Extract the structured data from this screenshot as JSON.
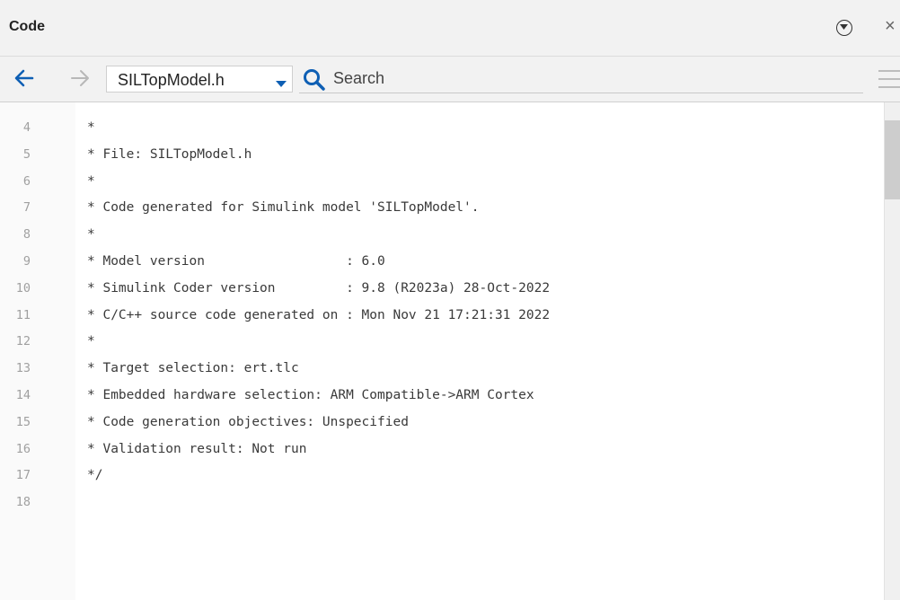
{
  "panel": {
    "title": "Code",
    "menu_icon": "circle-chevron-down-icon",
    "close_label": "×"
  },
  "toolbar": {
    "back_icon": "arrow-left-icon",
    "forward_icon": "arrow-right-icon",
    "file_selector": "SILTopModel.h",
    "search_placeholder": "Search",
    "search_value": "",
    "menu_icon": "hamburger-icon"
  },
  "colors": {
    "accent": "#0e5fb4",
    "line_number": "#a0a0a0",
    "code_text": "#3a3a3a"
  },
  "editor": {
    "lines": [
      {
        "n": "4",
        "text": "*"
      },
      {
        "n": "5",
        "text": "* File: SILTopModel.h"
      },
      {
        "n": "6",
        "text": "*"
      },
      {
        "n": "7",
        "text": "* Code generated for Simulink model 'SILTopModel'."
      },
      {
        "n": "8",
        "text": "*"
      },
      {
        "n": "9",
        "text": "* Model version                  : 6.0"
      },
      {
        "n": "10",
        "text": "* Simulink Coder version         : 9.8 (R2023a) 28-Oct-2022"
      },
      {
        "n": "11",
        "text": "* C/C++ source code generated on : Mon Nov 21 17:21:31 2022"
      },
      {
        "n": "12",
        "text": "*"
      },
      {
        "n": "13",
        "text": "* Target selection: ert.tlc"
      },
      {
        "n": "14",
        "text": "* Embedded hardware selection: ARM Compatible->ARM Cortex"
      },
      {
        "n": "15",
        "text": "* Code generation objectives: Unspecified"
      },
      {
        "n": "16",
        "text": "* Validation result: Not run"
      },
      {
        "n": "17",
        "text": "*/"
      },
      {
        "n": "18",
        "text": ""
      }
    ]
  }
}
